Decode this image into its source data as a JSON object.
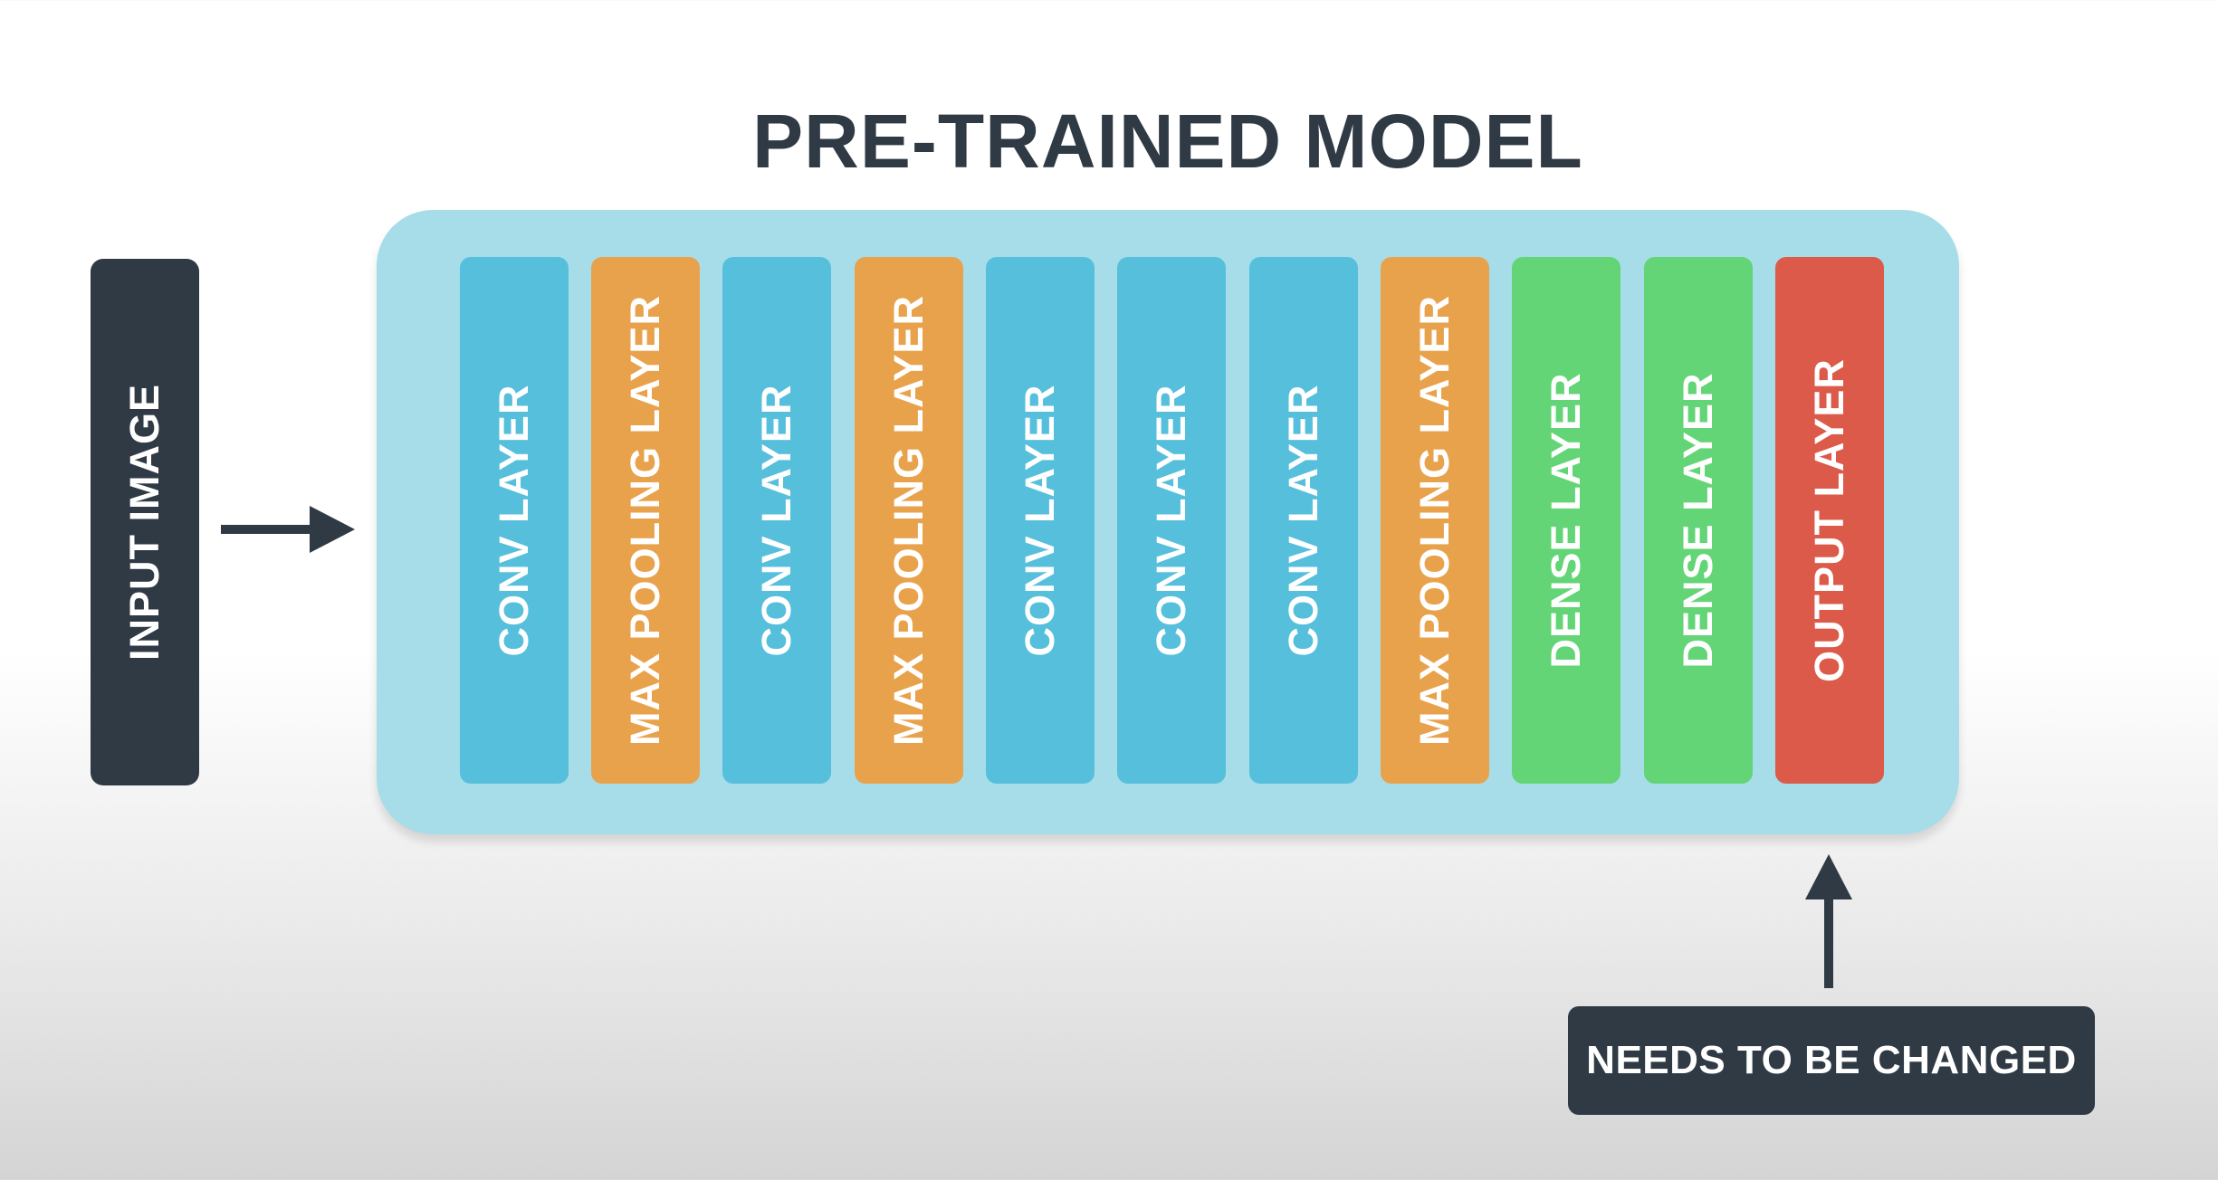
{
  "title": "PRE-TRAINED MODEL",
  "input": {
    "label": "INPUT IMAGE"
  },
  "layers": [
    {
      "label": "CONV LAYER",
      "kind": "conv"
    },
    {
      "label": "MAX POOLING LAYER",
      "kind": "pool"
    },
    {
      "label": "CONV LAYER",
      "kind": "conv"
    },
    {
      "label": "MAX POOLING LAYER",
      "kind": "pool"
    },
    {
      "label": "CONV LAYER",
      "kind": "conv"
    },
    {
      "label": "CONV LAYER",
      "kind": "conv"
    },
    {
      "label": "CONV LAYER",
      "kind": "conv"
    },
    {
      "label": "MAX POOLING LAYER",
      "kind": "pool"
    },
    {
      "label": "DENSE LAYER",
      "kind": "dense"
    },
    {
      "label": "DENSE LAYER",
      "kind": "dense"
    },
    {
      "label": "OUTPUT LAYER",
      "kind": "output"
    }
  ],
  "callout": {
    "label": "NEEDS TO BE CHANGED"
  },
  "colors": {
    "dark": "#2f3a45",
    "panel": "#a6dde9",
    "conv": "#56bfdc",
    "pool": "#e9a24c",
    "dense": "#63d576",
    "output": "#dc5a49"
  }
}
